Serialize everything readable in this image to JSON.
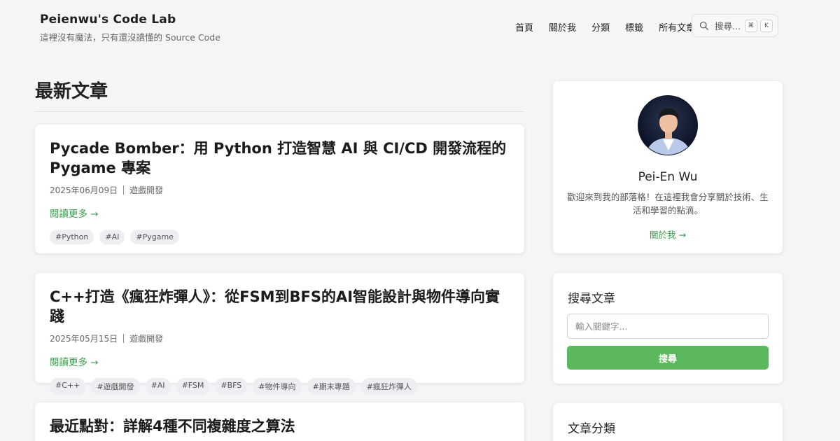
{
  "header": {
    "site_title": "Peienwu's Code Lab",
    "tagline": "這裡沒有魔法，只有還沒讀懂的 Source Code",
    "nav": [
      "首頁",
      "關於我",
      "分類",
      "標籤",
      "所有文章"
    ],
    "search_placeholder": "搜尋...",
    "shortcut_keys": [
      "⌘",
      "K"
    ]
  },
  "main": {
    "section_title": "最新文章",
    "read_more_label": "閱讀更多 →",
    "posts": [
      {
        "title": "Pycade Bomber：用 Python 打造智慧 AI 與 CI/CD 開發流程的 Pygame 專案",
        "date": "2025年06月09日",
        "category": "遊戲開發",
        "tags": [
          "#Python",
          "#AI",
          "#Pygame"
        ]
      },
      {
        "title": "C++打造《瘋狂炸彈人》：從FSM到BFS的AI智能設計與物件導向實踐",
        "date": "2025年05月15日",
        "category": "遊戲開發",
        "tags": [
          "#C++",
          "#遊戲開發",
          "#AI",
          "#FSM",
          "#BFS",
          "#物件導向",
          "#期末專題",
          "#瘋狂炸彈人"
        ]
      },
      {
        "title": "最近點對：詳解4種不同複雜度之算法"
      }
    ]
  },
  "sidebar": {
    "profile": {
      "name": "Pei-En Wu",
      "bio": "歡迎來到我的部落格！在這裡我會分享關於技術、生活和學習的點滴。",
      "about_link": "關於我 →"
    },
    "search": {
      "title": "搜尋文章",
      "placeholder": "輸入關鍵字...",
      "button": "搜尋"
    },
    "categories": {
      "title": "文章分類"
    }
  },
  "colors": {
    "accent_green": "#3a9b4d",
    "button_green": "#5cb85c",
    "background": "#f4f5f7"
  }
}
